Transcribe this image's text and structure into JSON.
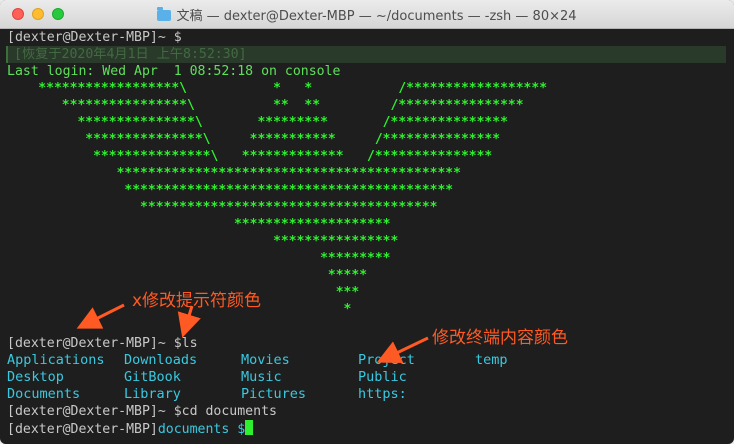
{
  "window": {
    "title": "文稿 — dexter@Dexter-MBP — ~/documents — -zsh — 80×24"
  },
  "terminal": {
    "line1": "[dexter@Dexter-MBP]~ $",
    "restored": "[恢复于2020年4月1日 上午8:52:30]",
    "last_login": "Last login: Wed Apr  1 08:52:18 on console",
    "art": [
      "    ******************\\           *   *           /******************",
      "       ****************\\          **  **         /****************",
      "         ***************\\       *********       /***************",
      "          ***************\\     ***********     /***************",
      "           ***************\\   *************   /***************",
      "              ********************************************",
      "               ******************************************",
      "                 **************************************",
      "                             ********************",
      "                                  ****************",
      "                                        *********",
      "                                         *****",
      "                                          ***",
      "                                           *"
    ],
    "prompt_ls": "[dexter@Dexter-MBP]~ $ls",
    "ls_columns": [
      [
        "Applications",
        "Desktop",
        "Documents"
      ],
      [
        "Downloads",
        "GitBook",
        "Library"
      ],
      [
        "Movies",
        "Music",
        "Pictures"
      ],
      [
        "Project",
        "Public",
        "https:"
      ],
      [
        "temp"
      ]
    ],
    "prompt_cd": "[dexter@Dexter-MBP]~ $cd documents",
    "prompt_final_user": "[dexter@Dexter-MBP]",
    "prompt_final_dir": "documents $"
  },
  "annotations": {
    "prompt_color": "x修改提示符颜色",
    "content_color": "修改终端内容颜色"
  },
  "colors": {
    "accent_annotation": "#ff5a23",
    "art_green": "#2ff02f",
    "ls_cyan": "#39c9e0"
  }
}
